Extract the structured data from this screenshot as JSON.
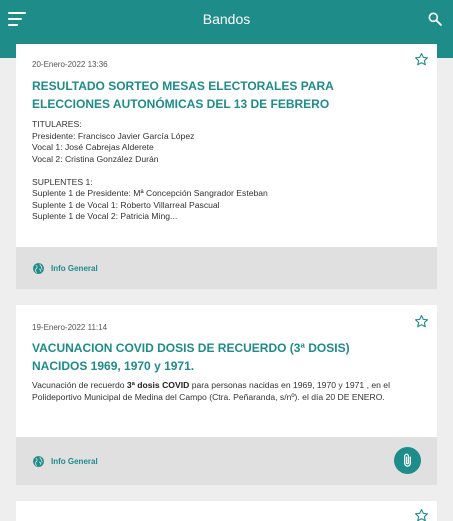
{
  "app": {
    "title": "Bandos"
  },
  "icons": {
    "menu": "menu-icon",
    "search": "search-icon",
    "favorite": "star-outline-icon",
    "category": "globe-icon",
    "attachment": "paperclip-icon"
  },
  "colors": {
    "primary": "#1e8c89",
    "footer": "#e0e0e0",
    "background": "#eeeeee"
  },
  "cards": [
    {
      "date": "20-Enero-2022 13:36",
      "title": "RESULTADO SORTEO MESAS ELECTORALES PARA ELECCIONES AUTONÓMICAS DEL 13 DE FEBRERO",
      "body": "TITULARES:\nPresidente: Francisco Javier García López\nVocal 1: José Cabrejas Alderete\nVocal 2: Cristina González Durán\n\nSUPLENTES 1:\nSuplente 1 de Presidente: Mª Concepción Sangrador Esteban\nSuplente 1 de Vocal 1: Roberto Villarreal Pascual\nSuplente 1 de Vocal 2: Patricia Ming...",
      "category": "Info General"
    },
    {
      "date": "19-Enero-2022 11:14",
      "title": "VACUNACION COVID DOSIS DE RECUERDO (3ª DOSIS) NACIDOS 1969, 1970 y 1971.",
      "body_pre": "Vacunación de recuerdo ",
      "body_bold": "3ª dosis COVID",
      "body_post": " para personas nacidas en 1969, 1970 y 1971 , en el Polideportivo Municipal de Medina del Campo (Ctra. Peñaranda, s/nº). el día 20 DE ENERO.",
      "category": "Info General"
    }
  ]
}
